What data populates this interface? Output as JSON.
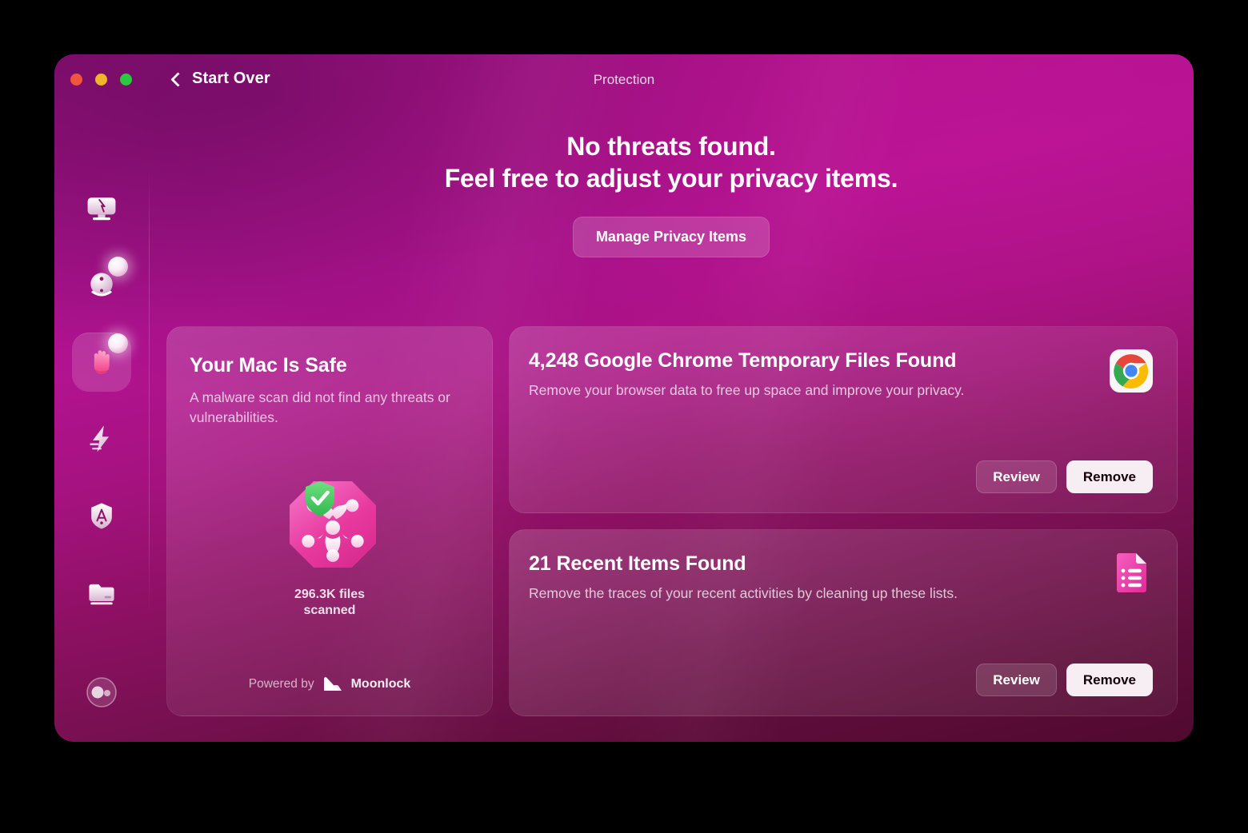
{
  "window": {
    "title": "Protection",
    "back_label": "Start Over",
    "traffic_lights": [
      "close",
      "minimize",
      "zoom"
    ],
    "colors": {
      "close": "#f2553d",
      "minimize": "#f0b429",
      "zoom": "#2cc840",
      "background_top": "#b51394",
      "background_bottom": "#50092f",
      "accent_pink": "#ec4ab0",
      "safe_green": "#44c767"
    }
  },
  "sidebar": {
    "items": [
      {
        "icon": "cleanup-monitor-icon",
        "name": "sidebar-item-cleanup",
        "selected": false,
        "badge": false
      },
      {
        "icon": "smart-scan-orb-icon",
        "name": "sidebar-item-smart-scan",
        "selected": false,
        "badge": true
      },
      {
        "icon": "protection-hand-icon",
        "name": "sidebar-item-protection",
        "selected": true,
        "badge": true
      },
      {
        "icon": "performance-bolt-icon",
        "name": "sidebar-item-performance",
        "selected": false,
        "badge": false
      },
      {
        "icon": "applications-shield-icon",
        "name": "sidebar-item-applications",
        "selected": false,
        "badge": false
      },
      {
        "icon": "my-clutter-drawer-icon",
        "name": "sidebar-item-my-clutter",
        "selected": false,
        "badge": false
      }
    ],
    "account": {
      "icon": "account-avatar-icon",
      "name": "sidebar-item-account"
    }
  },
  "hero": {
    "headline_line1": "No threats found.",
    "headline_line2": "Feel free to adjust your privacy items.",
    "cta_label": "Manage Privacy Items"
  },
  "safe_card": {
    "title": "Your Mac Is Safe",
    "subtitle": "A malware scan did not find any threats or vulnerabilities.",
    "visual_icon": "biohazard-shield-icon",
    "scanned_count": "296.3K files",
    "scanned_label": "scanned",
    "powered_by_prefix": "Powered by",
    "powered_by_brand": "Moonlock",
    "powered_by_icon": "moonlock-logo-icon"
  },
  "findings": [
    {
      "title": "4,248 Google Chrome Temporary Files Found",
      "subtitle": "Remove your browser data to free up space and improve your privacy.",
      "icon": "google-chrome-icon",
      "review_label": "Review",
      "remove_label": "Remove"
    },
    {
      "title": "21 Recent Items Found",
      "subtitle": "Remove the traces of your recent activities by cleaning up these lists.",
      "icon": "recent-items-list-icon",
      "review_label": "Review",
      "remove_label": "Remove"
    }
  ]
}
